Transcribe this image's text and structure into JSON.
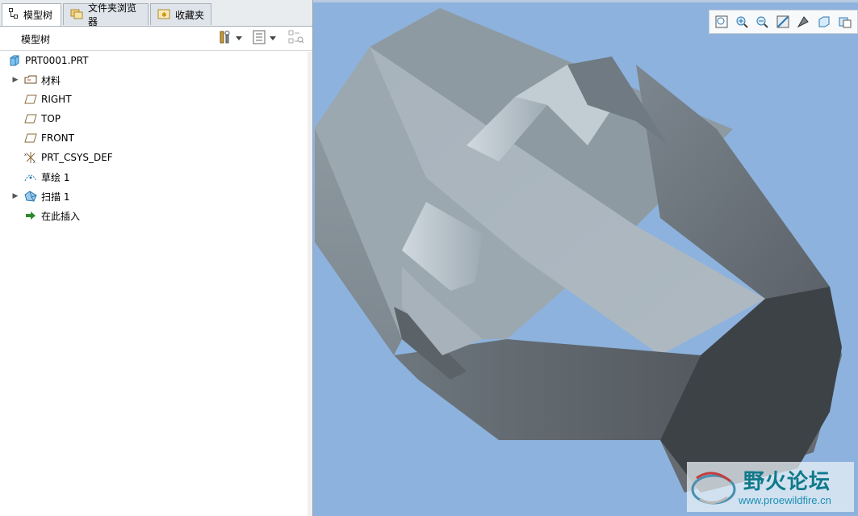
{
  "tabs": [
    {
      "label": "模型树",
      "icon": "model-tree-icon",
      "active": true
    },
    {
      "label": "文件夹浏览器",
      "icon": "folder-browser-icon",
      "active": false
    },
    {
      "label": "收藏夹",
      "icon": "favorites-icon",
      "active": false
    }
  ],
  "toolbar": {
    "title": "模型树",
    "settings_icon": "tools-icon",
    "show_icon": "list-icon",
    "filter_icon": "filter-icon"
  },
  "tree": {
    "items": [
      {
        "label": "PRT0001.PRT",
        "icon": "part-icon",
        "expandable": false
      },
      {
        "label": "材料",
        "icon": "material-icon",
        "expandable": true
      },
      {
        "label": "RIGHT",
        "icon": "datum-plane-icon",
        "expandable": false
      },
      {
        "label": "TOP",
        "icon": "datum-plane-icon",
        "expandable": false
      },
      {
        "label": "FRONT",
        "icon": "datum-plane-icon",
        "expandable": false
      },
      {
        "label": "PRT_CSYS_DEF",
        "icon": "csys-icon",
        "expandable": false
      },
      {
        "label": "草绘 1",
        "icon": "sketch-icon",
        "expandable": false
      },
      {
        "label": "扫描 1",
        "icon": "sweep-icon",
        "expandable": true
      },
      {
        "label": "在此插入",
        "icon": "insert-here-icon",
        "expandable": false
      }
    ]
  },
  "viewport": {
    "background": "#8db2dd",
    "toolbar": [
      "refit-icon",
      "zoom-in-icon",
      "zoom-out-icon",
      "repaint-icon",
      "display-style-icon",
      "saved-orientations-icon",
      "view-manager-icon"
    ]
  },
  "watermark": {
    "title": "野火论坛",
    "url": "www.proewildfire.cn"
  },
  "colors": {
    "accent": "#0f7a8a",
    "model_light": "#b7c2cb",
    "model_dark": "#3a4046"
  }
}
